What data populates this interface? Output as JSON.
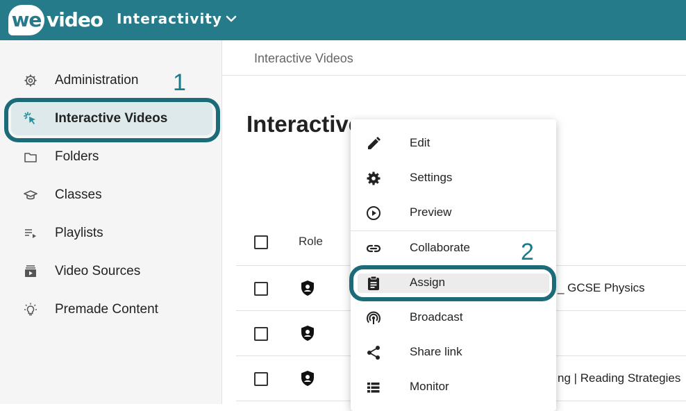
{
  "header": {
    "logo_we": "we",
    "logo_video": "video",
    "product": "Interactivity"
  },
  "sidebar": {
    "items": [
      {
        "label": "Administration",
        "icon": "gear-icon"
      },
      {
        "label": "Interactive Videos",
        "icon": "cursor-click-icon",
        "active": true
      },
      {
        "label": "Folders",
        "icon": "folder-icon"
      },
      {
        "label": "Classes",
        "icon": "graduation-cap-icon"
      },
      {
        "label": "Playlists",
        "icon": "playlist-icon"
      },
      {
        "label": "Video Sources",
        "icon": "video-library-icon"
      },
      {
        "label": "Premade Content",
        "icon": "lightbulb-icon"
      }
    ]
  },
  "breadcrumb": "Interactive Videos",
  "page_title": "Interactive Videos",
  "table": {
    "columns": {
      "role": "Role"
    },
    "rows": [
      {
        "title_fragment": "_ GCSE Physics",
        "role_icon": "shield-user-icon"
      },
      {
        "title_fragment": "",
        "role_icon": "shield-user-icon"
      },
      {
        "title_fragment": "ng | Reading Strategies",
        "role_icon": "shield-user-icon"
      }
    ]
  },
  "context_menu": {
    "items": [
      {
        "label": "Edit",
        "icon": "pencil-icon"
      },
      {
        "label": "Settings",
        "icon": "gear-icon"
      },
      {
        "label": "Preview",
        "icon": "play-circle-icon"
      },
      {
        "label": "Collaborate",
        "icon": "link-icon"
      },
      {
        "label": "Assign",
        "icon": "clipboard-icon",
        "highlighted": true
      },
      {
        "label": "Broadcast",
        "icon": "broadcast-icon"
      },
      {
        "label": "Share link",
        "icon": "share-icon"
      },
      {
        "label": "Monitor",
        "icon": "list-icon"
      }
    ]
  },
  "callouts": [
    "1",
    "2"
  ],
  "colors": {
    "topbar": "#267b8b",
    "accent": "#1b6b78",
    "active_bg": "#dde9ea"
  }
}
